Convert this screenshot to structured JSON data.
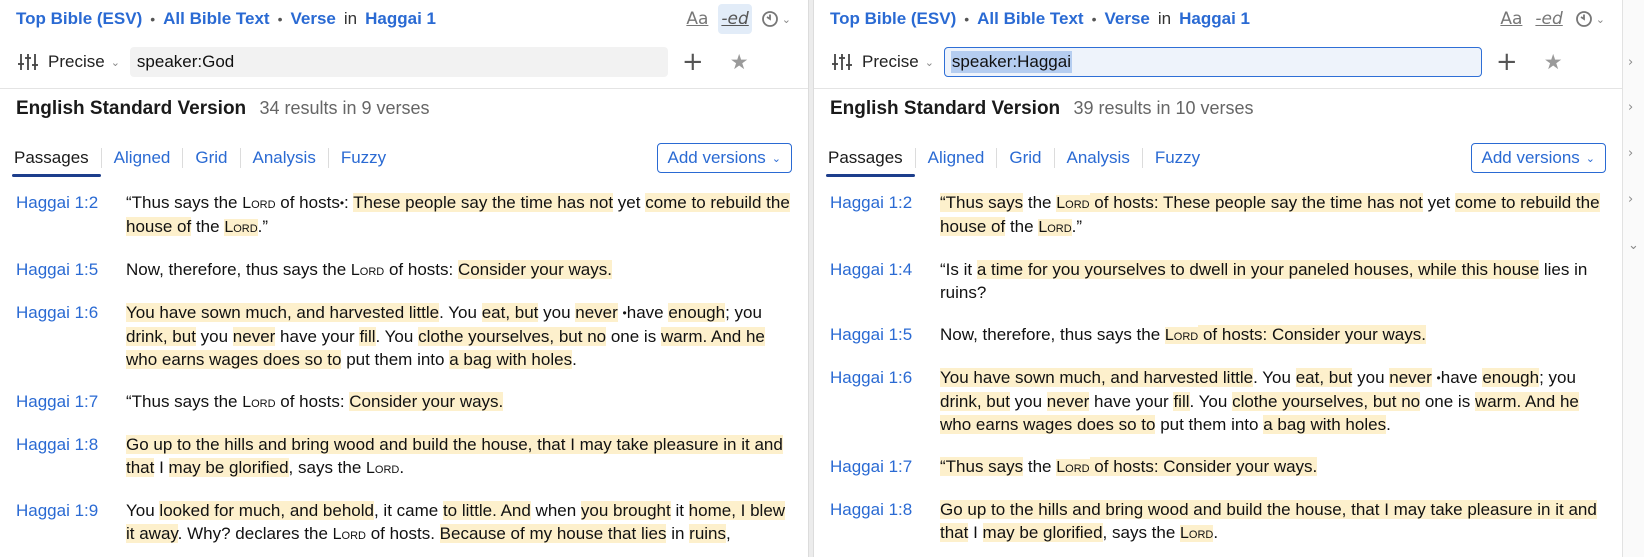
{
  "panels": [
    {
      "breadcrumb": {
        "source": "Top Bible (ESV)",
        "scope": "All Bible Text",
        "unit": "Verse",
        "in_label": "in",
        "passage": "Haggai 1"
      },
      "icons": {
        "font": "Aa",
        "ed": "-ed"
      },
      "search": {
        "mode": "Precise",
        "query": "speaker:God"
      },
      "version": {
        "name": "English Standard Version",
        "count": "34 results in 9 verses"
      },
      "tabs": [
        "Passages",
        "Aligned",
        "Grid",
        "Analysis",
        "Fuzzy"
      ],
      "add_versions": "Add versions",
      "results": [
        {
          "ref": "Haggai 1:2",
          "parts": [
            {
              "t": "“Thus says the "
            },
            {
              "t": "Lord",
              "sc": true
            },
            {
              "t": " of hosts"
            },
            {
              "t": "•",
              "b": true
            },
            {
              "t": ": "
            },
            {
              "t": "These people say the time has not",
              "h": true
            },
            {
              "t": " yet "
            },
            {
              "t": "come to rebuild the house of",
              "h": true
            },
            {
              "t": " the "
            },
            {
              "t": "Lord",
              "sc": true,
              "h": true
            },
            {
              "t": ".”"
            }
          ]
        },
        {
          "ref": "Haggai 1:5",
          "parts": [
            {
              "t": "Now, therefore, thus says the "
            },
            {
              "t": "Lord",
              "sc": true
            },
            {
              "t": " of hosts: "
            },
            {
              "t": "Consider your ways.",
              "h": true
            }
          ]
        },
        {
          "ref": "Haggai 1:6",
          "parts": [
            {
              "t": "You have sown much, and harvested little",
              "h": true
            },
            {
              "t": ". You "
            },
            {
              "t": "eat, but",
              "h": true
            },
            {
              "t": " you "
            },
            {
              "t": "never",
              "h": true
            },
            {
              "t": " "
            },
            {
              "t": "•",
              "b": true
            },
            {
              "t": "have "
            },
            {
              "t": "enough",
              "h": true
            },
            {
              "t": "; you "
            },
            {
              "t": "drink, but",
              "h": true
            },
            {
              "t": " you "
            },
            {
              "t": "never",
              "h": true
            },
            {
              "t": " have your "
            },
            {
              "t": "fill",
              "h": true
            },
            {
              "t": ". You "
            },
            {
              "t": "clothe yourselves, but no",
              "h": true
            },
            {
              "t": " one is "
            },
            {
              "t": "warm. And he who earns wages does so to",
              "h": true
            },
            {
              "t": " put them into "
            },
            {
              "t": "a bag with holes",
              "h": true
            },
            {
              "t": "."
            }
          ]
        },
        {
          "ref": "Haggai 1:7",
          "parts": [
            {
              "t": "“Thus says the "
            },
            {
              "t": "Lord",
              "sc": true
            },
            {
              "t": " of hosts: "
            },
            {
              "t": "Consider your ways.",
              "h": true
            }
          ]
        },
        {
          "ref": "Haggai 1:8",
          "parts": [
            {
              "t": "Go up to the hills and bring wood and build the house, that I may take pleasure in it and that",
              "h": true
            },
            {
              "t": " I "
            },
            {
              "t": "may be glorified",
              "h": true
            },
            {
              "t": ", says the "
            },
            {
              "t": "Lord",
              "sc": true
            },
            {
              "t": "."
            }
          ]
        },
        {
          "ref": "Haggai 1:9",
          "parts": [
            {
              "t": "You "
            },
            {
              "t": "looked for much, and behold",
              "h": true
            },
            {
              "t": ", it came "
            },
            {
              "t": "to little. And",
              "h": true
            },
            {
              "t": " when "
            },
            {
              "t": "you brought",
              "h": true
            },
            {
              "t": " it "
            },
            {
              "t": "home, I blew it away",
              "h": true
            },
            {
              "t": ". Why? declares the "
            },
            {
              "t": "Lord",
              "sc": true
            },
            {
              "t": " of hosts. "
            },
            {
              "t": "Because of my house that lies",
              "h": true
            },
            {
              "t": " in "
            },
            {
              "t": "ruins",
              "h": true
            },
            {
              "t": ","
            }
          ]
        }
      ]
    },
    {
      "breadcrumb": {
        "source": "Top Bible (ESV)",
        "scope": "All Bible Text",
        "unit": "Verse",
        "in_label": "in",
        "passage": "Haggai 1"
      },
      "icons": {
        "font": "Aa",
        "ed": "-ed"
      },
      "search": {
        "mode": "Precise",
        "query": "speaker:Haggai"
      },
      "version": {
        "name": "English Standard Version",
        "count": "39 results in 10 verses"
      },
      "tabs": [
        "Passages",
        "Aligned",
        "Grid",
        "Analysis",
        "Fuzzy"
      ],
      "add_versions": "Add versions",
      "results": [
        {
          "ref": "Haggai 1:2",
          "parts": [
            {
              "t": "“Thus says",
              "h": true
            },
            {
              "t": " the "
            },
            {
              "t": "Lord",
              "sc": true,
              "h": true
            },
            {
              "t": " of hosts: These people say the time has not",
              "h": true
            },
            {
              "t": " yet "
            },
            {
              "t": "come to rebuild the house of",
              "h": true
            },
            {
              "t": " the "
            },
            {
              "t": "Lord",
              "sc": true,
              "h": true
            },
            {
              "t": ".”"
            }
          ]
        },
        {
          "ref": "Haggai 1:4",
          "parts": [
            {
              "t": "“Is it "
            },
            {
              "t": "a time for you yourselves to dwell in your paneled houses, while this house",
              "h": true
            },
            {
              "t": " lies in ruins?"
            }
          ]
        },
        {
          "ref": "Haggai 1:5",
          "parts": [
            {
              "t": "Now, therefore, thus says the "
            },
            {
              "t": "Lord",
              "sc": true,
              "h": true
            },
            {
              "t": " of hosts: Consider your ways.",
              "h": true
            }
          ]
        },
        {
          "ref": "Haggai 1:6",
          "parts": [
            {
              "t": "You have sown much, and harvested little",
              "h": true
            },
            {
              "t": ". You "
            },
            {
              "t": "eat, but",
              "h": true
            },
            {
              "t": " you "
            },
            {
              "t": "never",
              "h": true
            },
            {
              "t": " "
            },
            {
              "t": "•",
              "b": true
            },
            {
              "t": "have "
            },
            {
              "t": "enough",
              "h": true
            },
            {
              "t": "; you "
            },
            {
              "t": "drink, but",
              "h": true
            },
            {
              "t": " you "
            },
            {
              "t": "never",
              "h": true
            },
            {
              "t": " have your "
            },
            {
              "t": "fill",
              "h": true
            },
            {
              "t": ". You "
            },
            {
              "t": "clothe yourselves, but no",
              "h": true
            },
            {
              "t": " one is "
            },
            {
              "t": "warm. And he who earns wages does so to",
              "h": true
            },
            {
              "t": " put them into "
            },
            {
              "t": "a bag with holes",
              "h": true
            },
            {
              "t": "."
            }
          ]
        },
        {
          "ref": "Haggai 1:7",
          "parts": [
            {
              "t": "“Thus says",
              "h": true
            },
            {
              "t": " the "
            },
            {
              "t": "Lord",
              "sc": true,
              "h": true
            },
            {
              "t": " of hosts: Consider your ways.",
              "h": true
            }
          ]
        },
        {
          "ref": "Haggai 1:8",
          "parts": [
            {
              "t": "Go up to the hills and bring wood and build the house, that I may take pleasure in it and that",
              "h": true
            },
            {
              "t": " I "
            },
            {
              "t": "may be glorified",
              "h": true
            },
            {
              "t": ", says the "
            },
            {
              "t": "Lord",
              "sc": true,
              "h": true
            },
            {
              "t": "."
            }
          ]
        }
      ]
    }
  ]
}
